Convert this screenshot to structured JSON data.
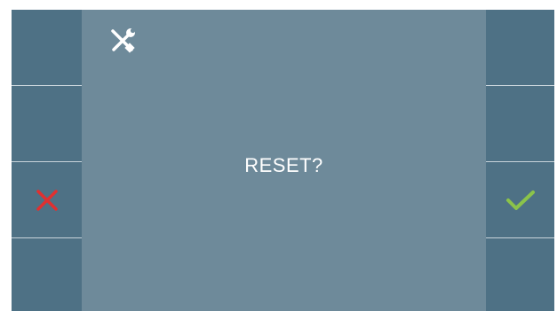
{
  "screen": {
    "prompt": "RESET?",
    "header_icon": "tools-icon",
    "left_buttons": [
      {
        "icon": ""
      },
      {
        "icon": ""
      },
      {
        "icon": "close-icon",
        "color": "#e03030"
      },
      {
        "icon": ""
      }
    ],
    "right_buttons": [
      {
        "icon": ""
      },
      {
        "icon": ""
      },
      {
        "icon": "checkmark-icon",
        "color": "#8bc34a"
      },
      {
        "icon": ""
      }
    ]
  },
  "colors": {
    "side_panel": "#4e7185",
    "center_panel": "#6e8a9a",
    "divider": "#c8d4db",
    "cancel": "#e03030",
    "confirm": "#8bc34a"
  }
}
